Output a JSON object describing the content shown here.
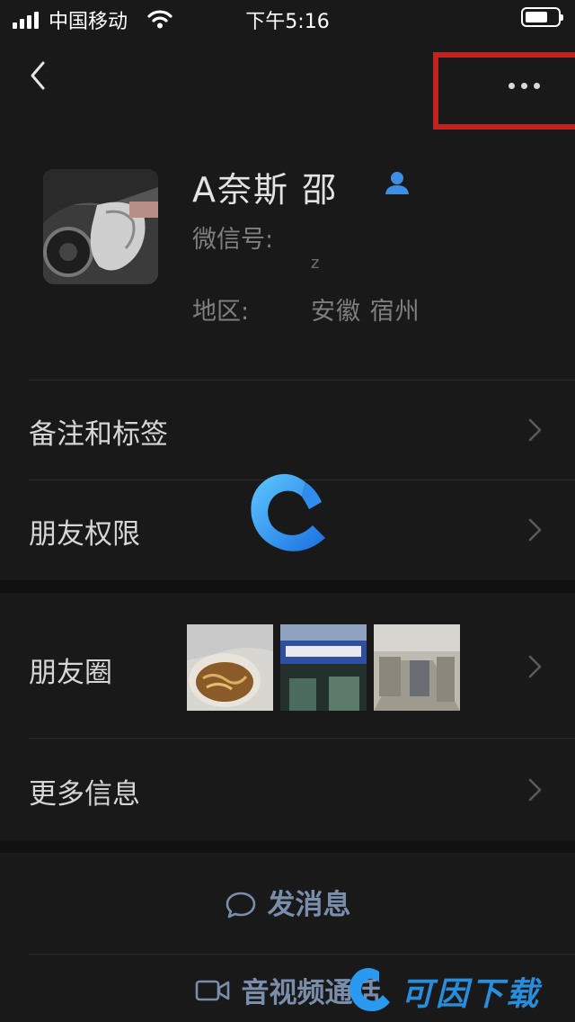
{
  "status_bar": {
    "carrier": "中国移动",
    "time": "下午5:16",
    "battery_level": 0.7
  },
  "nav": {
    "back_icon": "chevron-left-icon",
    "more_icon": "more-dots-icon"
  },
  "profile": {
    "name": "A奈斯   邵",
    "wechat_id_label": "微信号:",
    "wechat_id_value": "z",
    "region_label": "地区:",
    "region_value": "安徽 宿州"
  },
  "rows": {
    "remarks_tags": "备注和标签",
    "friend_permissions": "朋友权限",
    "moments": "朋友圈",
    "more_info": "更多信息"
  },
  "actions": {
    "send_message": "发消息",
    "video_call": "音视频通话"
  },
  "watermark": {
    "text": "可因下载"
  },
  "colors": {
    "background": "#191919",
    "highlight_box": "#c4221d",
    "action_text": "#7a8eab",
    "verified": "#3d8fe6",
    "watermark": "#2a9af0"
  }
}
